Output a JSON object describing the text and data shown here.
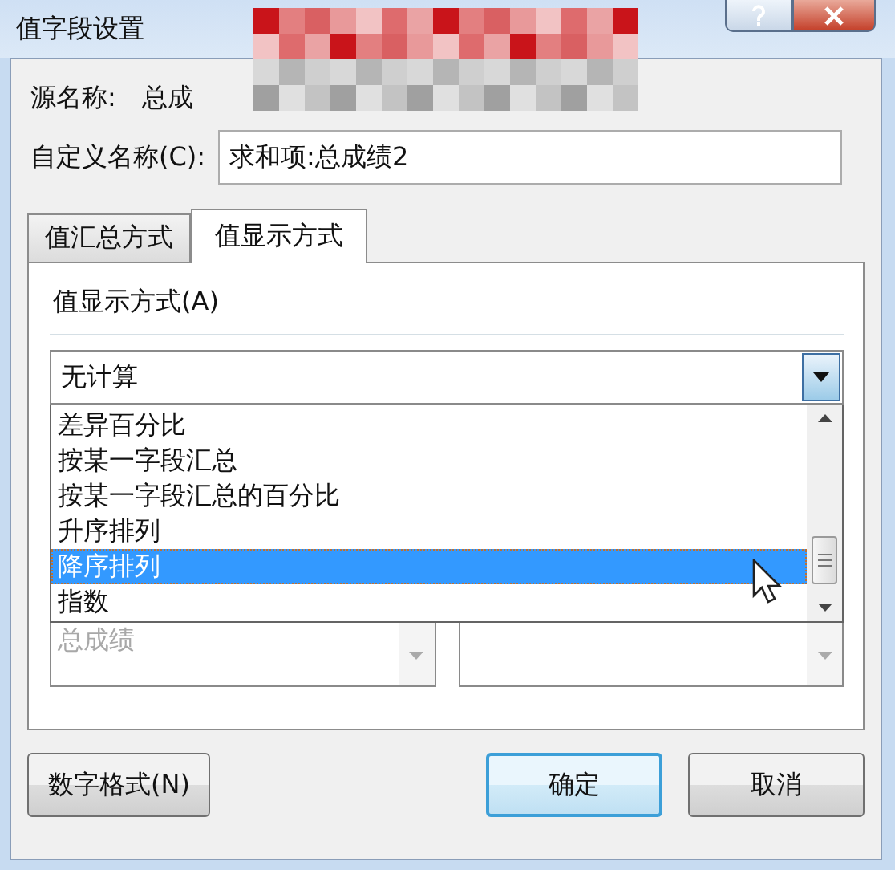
{
  "window": {
    "title": "值字段设置"
  },
  "source_name": {
    "label": "源名称:",
    "value": "总成"
  },
  "custom_name": {
    "label": "自定义名称(C):",
    "value": "求和项:总成绩2"
  },
  "tabs": [
    {
      "label": "值汇总方式",
      "selected": false
    },
    {
      "label": "值显示方式",
      "selected": true
    }
  ],
  "show_values_as": {
    "label": "值显示方式(A)",
    "value": "无计算",
    "expanded": true,
    "options": [
      {
        "label": "差异百分比",
        "selected": false
      },
      {
        "label": "按某一字段汇总",
        "selected": false
      },
      {
        "label": "按某一字段汇总的百分比",
        "selected": false
      },
      {
        "label": "升序排列",
        "selected": false
      },
      {
        "label": "降序排列",
        "selected": true
      },
      {
        "label": "指数",
        "selected": false
      }
    ]
  },
  "base_field": {
    "items": [
      {
        "label": "总成绩",
        "disabled": true
      }
    ]
  },
  "buttons": [
    {
      "label": "数字格式(N)",
      "default": false
    },
    {
      "label": "确定",
      "default": true
    },
    {
      "label": "取消",
      "default": false
    }
  ]
}
